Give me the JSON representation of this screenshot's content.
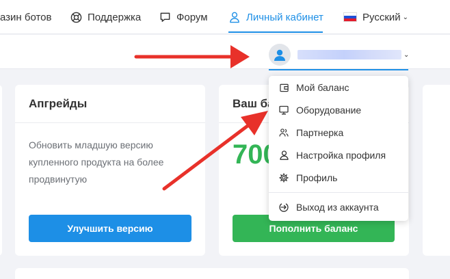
{
  "nav": {
    "bots_store": "азин ботов",
    "support": "Поддержка",
    "forum": "Форум",
    "cabinet": "Личный кабинет",
    "language": "Русский"
  },
  "colors": {
    "accent": "#1d8fe6",
    "green": "#33b556",
    "arrow": "#e8312a"
  },
  "card_upgrades": {
    "title": "Апгрейды",
    "description": "Обновить младшую версию купленного продукта на более продвинутую",
    "button": "Улучшить версию"
  },
  "card_balance": {
    "title": "Ваш ба",
    "amount": "700",
    "button": "Пополнить баланс"
  },
  "user_menu": {
    "items": [
      {
        "label": "Мой баланс",
        "icon": "wallet-icon"
      },
      {
        "label": "Оборудование",
        "icon": "monitor-icon"
      },
      {
        "label": "Партнерка",
        "icon": "partners-icon"
      },
      {
        "label": "Настройка профиля",
        "icon": "user-icon"
      },
      {
        "label": "Профиль",
        "icon": "gear-icon"
      }
    ],
    "logout": {
      "label": "Выход из аккаунта",
      "icon": "logout-icon"
    }
  }
}
